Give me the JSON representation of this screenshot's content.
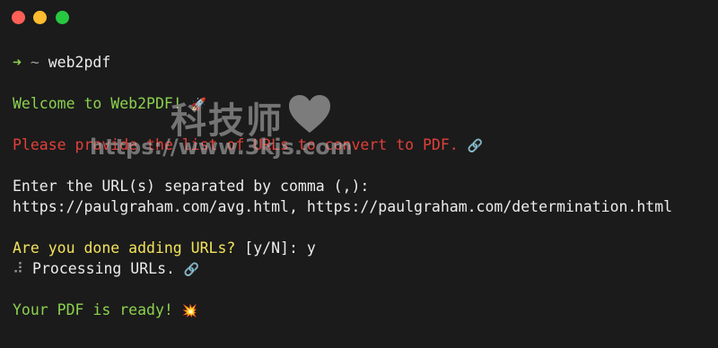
{
  "window": {
    "buttons": [
      "close",
      "minimize",
      "maximize"
    ]
  },
  "terminal": {
    "prompt_arrow": "➜",
    "prompt_dir": "~",
    "command": "web2pdf",
    "welcome": "Welcome to Web2PDF! ",
    "welcome_emoji": "🚀",
    "please_provide": "Please provide the list of URLs to convert to PDF. ",
    "link_emoji": "🔗",
    "enter_urls": "Enter the URL(s) separated by comma (,):",
    "urls_input": "https://paulgraham.com/avg.html, https://paulgraham.com/determination.html",
    "done_question": "Are you done adding URLs? ",
    "done_options": "[y/N]: y",
    "spinner": "⠼",
    "processing": " Processing URLs. ",
    "processing_emoji": "🔗",
    "ready": "Your PDF is ready! ",
    "ready_emoji": "💥"
  },
  "watermark": {
    "title": "科技师",
    "url": "https://www.3kjs.com"
  },
  "colors": {
    "background": "#1b1b1b",
    "green": "#8bd14f",
    "red": "#e0403a",
    "yellow": "#f2e35c",
    "text": "#ececec"
  }
}
